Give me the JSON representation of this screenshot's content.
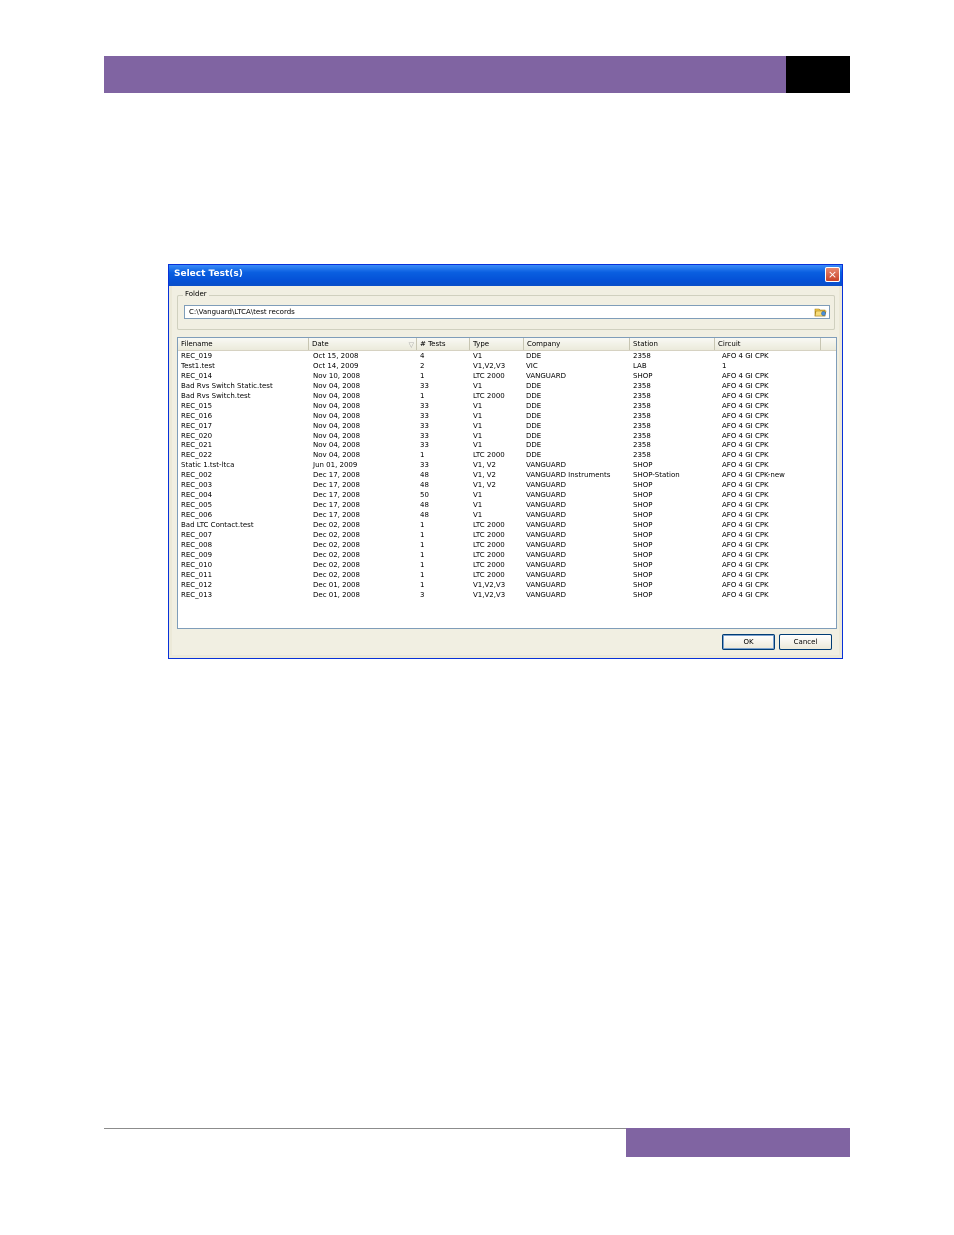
{
  "dialog": {
    "title": "Select Test(s)",
    "close_label": "×",
    "folder_label": "Folder",
    "folder_path": "C:\\Vanguard\\LTCA\\test records",
    "ok_label": "OK",
    "cancel_label": "Cancel"
  },
  "columns": [
    "Filename",
    "Date",
    "# Tests",
    "Type",
    "Company",
    "Station",
    "Circuit"
  ],
  "rows": [
    [
      "REC_019",
      "Oct 15, 2008",
      "4",
      "V1",
      "DDE",
      "2358",
      "AFO 4 GI CPK"
    ],
    [
      "Test1.test",
      "Oct 14, 2009",
      "2",
      "V1,V2,V3",
      "VIC",
      "LAB",
      "1"
    ],
    [
      "REC_014",
      "Nov 10, 2008",
      "1",
      "LTC 2000",
      "VANGUARD",
      "SHOP",
      "AFO 4 GI CPK"
    ],
    [
      "Bad Rvs Switch Static.test",
      "Nov 04, 2008",
      "33",
      "V1",
      "DDE",
      "2358",
      "AFO 4 GI CPK"
    ],
    [
      "Bad Rvs Switch.test",
      "Nov 04, 2008",
      "1",
      "LTC 2000",
      "DDE",
      "2358",
      "AFO 4 GI CPK"
    ],
    [
      "REC_015",
      "Nov 04, 2008",
      "33",
      "V1",
      "DDE",
      "2358",
      "AFO 4 GI CPK"
    ],
    [
      "REC_016",
      "Nov 04, 2008",
      "33",
      "V1",
      "DDE",
      "2358",
      "AFO 4 GI CPK"
    ],
    [
      "REC_017",
      "Nov 04, 2008",
      "33",
      "V1",
      "DDE",
      "2358",
      "AFO 4 GI CPK"
    ],
    [
      "REC_020",
      "Nov 04, 2008",
      "33",
      "V1",
      "DDE",
      "2358",
      "AFO 4 GI CPK"
    ],
    [
      "REC_021",
      "Nov 04, 2008",
      "33",
      "V1",
      "DDE",
      "2358",
      "AFO 4 GI CPK"
    ],
    [
      "REC_022",
      "Nov 04, 2008",
      "1",
      "LTC 2000",
      "DDE",
      "2358",
      "AFO 4 GI CPK"
    ],
    [
      "Static 1.tst-ltca",
      "Jun 01, 2009",
      "33",
      "V1, V2",
      "VANGUARD",
      "SHOP",
      "AFO 4 GI CPK"
    ],
    [
      "REC_002",
      "Dec 17, 2008",
      "48",
      "V1, V2",
      "VANGUARD Instruments",
      "SHOP-Station",
      "AFO 4 GI CPK-new"
    ],
    [
      "REC_003",
      "Dec 17, 2008",
      "48",
      "V1, V2",
      "VANGUARD",
      "SHOP",
      "AFO 4 GI CPK"
    ],
    [
      "REC_004",
      "Dec 17, 2008",
      "50",
      "V1",
      "VANGUARD",
      "SHOP",
      "AFO 4 GI CPK"
    ],
    [
      "REC_005",
      "Dec 17, 2008",
      "48",
      "V1",
      "VANGUARD",
      "SHOP",
      "AFO 4 GI CPK"
    ],
    [
      "REC_006",
      "Dec 17, 2008",
      "48",
      "V1",
      "VANGUARD",
      "SHOP",
      "AFO 4 GI CPK"
    ],
    [
      "Bad LTC Contact.test",
      "Dec 02, 2008",
      "1",
      "LTC 2000",
      "VANGUARD",
      "SHOP",
      "AFO 4 GI CPK"
    ],
    [
      "REC_007",
      "Dec 02, 2008",
      "1",
      "LTC 2000",
      "VANGUARD",
      "SHOP",
      "AFO 4 GI CPK"
    ],
    [
      "REC_008",
      "Dec 02, 2008",
      "1",
      "LTC 2000",
      "VANGUARD",
      "SHOP",
      "AFO 4 GI CPK"
    ],
    [
      "REC_009",
      "Dec 02, 2008",
      "1",
      "LTC 2000",
      "VANGUARD",
      "SHOP",
      "AFO 4 GI CPK"
    ],
    [
      "REC_010",
      "Dec 02, 2008",
      "1",
      "LTC 2000",
      "VANGUARD",
      "SHOP",
      "AFO 4 GI CPK"
    ],
    [
      "REC_011",
      "Dec 02, 2008",
      "1",
      "LTC 2000",
      "VANGUARD",
      "SHOP",
      "AFO 4 GI CPK"
    ],
    [
      "REC_012",
      "Dec 01, 2008",
      "1",
      "V1,V2,V3",
      "VANGUARD",
      "SHOP",
      "AFO 4 GI CPK"
    ],
    [
      "REC_013",
      "Dec 01, 2008",
      "3",
      "V1,V2,V3",
      "VANGUARD",
      "SHOP",
      "AFO 4 GI CPK"
    ]
  ],
  "icons": {
    "sort": "sort-indicator-icon",
    "browse": "folder-browse-icon",
    "close": "close-icon"
  },
  "colors": {
    "header_band": "#8064a2",
    "titlebar": "#0a5fe0",
    "dialog_bg": "#f1efe2"
  }
}
